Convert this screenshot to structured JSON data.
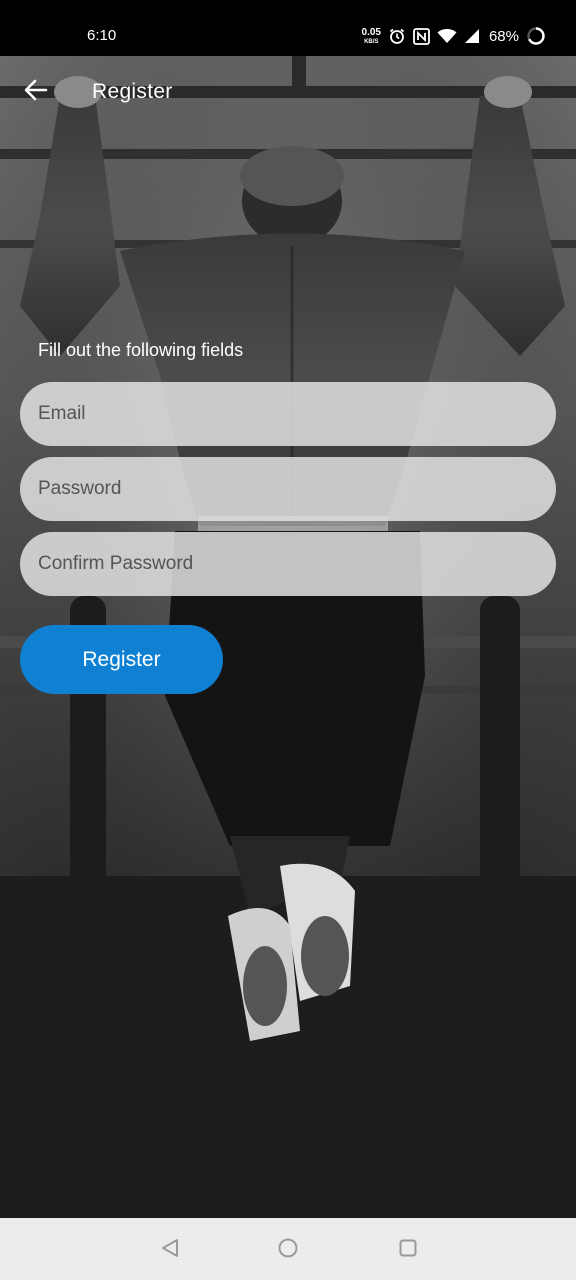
{
  "status_bar": {
    "time": "6:10",
    "net_speed_value": "0.05",
    "net_speed_unit": "KB/S",
    "battery_percent": "68%",
    "icons": [
      "alarm-icon",
      "nfc-icon",
      "wifi-icon",
      "cell-signal-icon",
      "battery-icon"
    ]
  },
  "app_bar": {
    "title": "Register",
    "back_icon": "arrow-left-icon"
  },
  "form": {
    "hint": "Fill out the following fields",
    "email_placeholder": "Email",
    "password_placeholder": "Password",
    "confirm_password_placeholder": "Confirm Password",
    "submit_label": "Register"
  },
  "colors": {
    "primary_button": "#0f80d2",
    "field_background": "#e1e1e1",
    "nav_bar": "#ececec"
  },
  "nav_bar": {
    "icons": [
      "back-triangle-icon",
      "home-circle-icon",
      "recents-square-icon"
    ]
  }
}
